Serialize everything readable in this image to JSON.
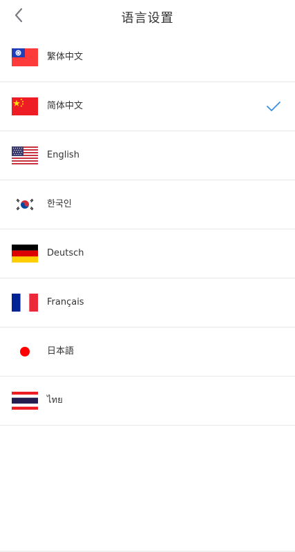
{
  "header": {
    "title": "语言设置",
    "back_icon": "chevron-left-icon"
  },
  "languages": [
    {
      "label": "繁体中文",
      "flag": "taiwan-flag-icon",
      "selected": false
    },
    {
      "label": "简体中文",
      "flag": "china-flag-icon",
      "selected": true
    },
    {
      "label": "English",
      "flag": "usa-flag-icon",
      "selected": false
    },
    {
      "label": "한국인",
      "flag": "korea-flag-icon",
      "selected": false
    },
    {
      "label": "Deutsch",
      "flag": "germany-flag-icon",
      "selected": false
    },
    {
      "label": "Français",
      "flag": "france-flag-icon",
      "selected": false
    },
    {
      "label": "日本語",
      "flag": "japan-flag-icon",
      "selected": false
    },
    {
      "label": "ไทย",
      "flag": "thailand-flag-icon",
      "selected": false
    }
  ],
  "colors": {
    "accent": "#3a8ee6",
    "text": "#333333",
    "divider": "#e6e6e6"
  }
}
